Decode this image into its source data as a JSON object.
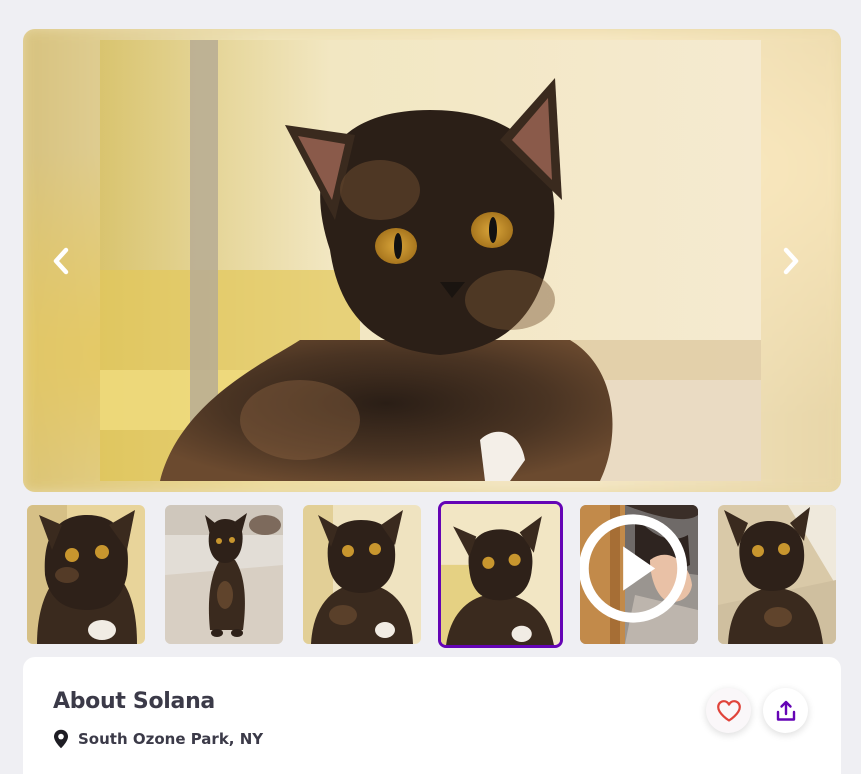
{
  "gallery": {
    "prev_icon": "chevron-left-icon",
    "next_icon": "chevron-right-icon",
    "thumbnails": [
      {
        "kind": "photo"
      },
      {
        "kind": "photo"
      },
      {
        "kind": "photo"
      },
      {
        "kind": "photo",
        "selected": true
      },
      {
        "kind": "video",
        "badge_icon": "play-icon"
      },
      {
        "kind": "photo"
      }
    ],
    "accent_color": "#6504b5"
  },
  "about": {
    "title": "About Solana",
    "location": "South Ozone Park, NY",
    "location_icon": "map-pin-icon",
    "favorite_icon": "heart-icon",
    "share_icon": "share-icon",
    "favorite_color": "#e0443b",
    "share_color": "#6504b5"
  }
}
